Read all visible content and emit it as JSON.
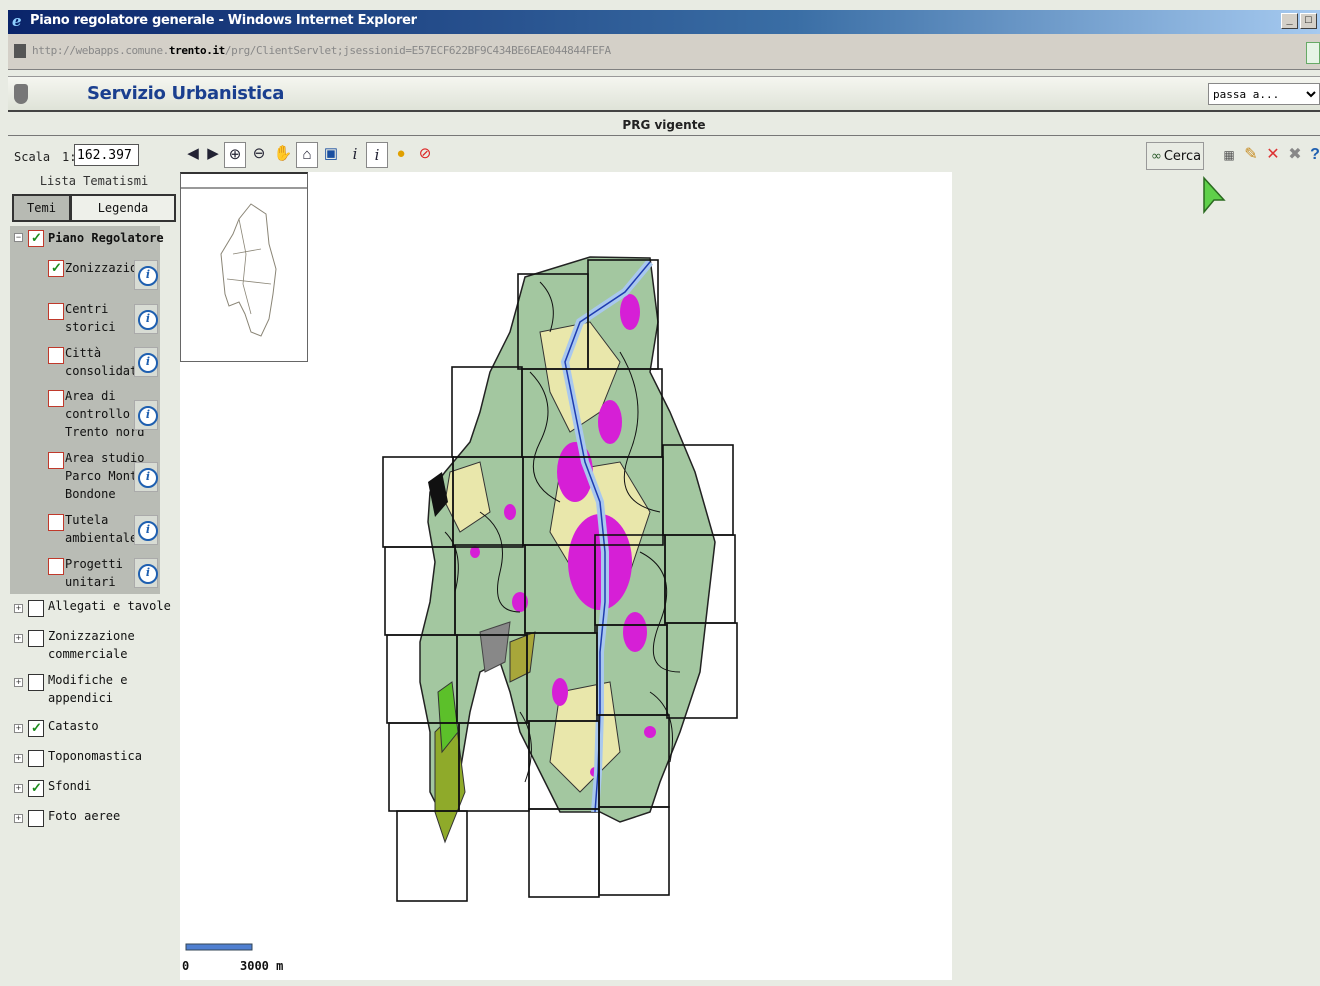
{
  "window": {
    "title": "Piano regolatore generale - Windows Internet Explorer",
    "buttons": [
      "_",
      "□"
    ]
  },
  "address": {
    "url_prefix": "http://webapps.comune.",
    "url_domain": "trento.it",
    "url_suffix": "/prg/ClientServlet;jsessionid=E57ECF622BF9C434BE6EAE044844FEFA"
  },
  "header": {
    "app_title": "Servizio Urbanistica",
    "jump_select": "passa a..."
  },
  "map_title": "PRG vigente",
  "scale": {
    "label": "Scala",
    "prefix": "1:",
    "value": "162.397"
  },
  "panel": {
    "lista_title": "Lista Tematismi",
    "tab_temi": "Temi",
    "tab_legenda": "Legenda"
  },
  "tree": {
    "group": {
      "label": "Piano Regolatore",
      "checked": true
    },
    "layers": [
      {
        "lines": [
          "Zonizzazione"
        ],
        "checked": true
      },
      {
        "lines": [
          "Centri",
          "storici"
        ],
        "checked": false
      },
      {
        "lines": [
          "Città",
          "consolidata"
        ],
        "checked": false
      },
      {
        "lines": [
          "Area di",
          "controllo",
          "Trento nord"
        ],
        "checked": false
      },
      {
        "lines": [
          "Area studio",
          "Parco Monte",
          "Bondone"
        ],
        "checked": false
      },
      {
        "lines": [
          "Tutela",
          "ambientale"
        ],
        "checked": false
      },
      {
        "lines": [
          "Progetti",
          "unitari"
        ],
        "checked": false
      }
    ],
    "groups": [
      {
        "lines": [
          "Allegati e tavole"
        ],
        "checked": false
      },
      {
        "lines": [
          "Zonizzazione",
          "commerciale"
        ],
        "checked": false
      },
      {
        "lines": [
          "Modifiche e",
          "appendici"
        ],
        "checked": false
      },
      {
        "lines": [
          "Catasto"
        ],
        "checked": true
      },
      {
        "lines": [
          "Toponomastica"
        ],
        "checked": false
      },
      {
        "lines": [
          "Sfondi"
        ],
        "checked": true
      },
      {
        "lines": [
          "Foto aeree"
        ],
        "checked": false
      }
    ]
  },
  "right_tools": {
    "cerca_label": "Cerca"
  },
  "scalebar": {
    "start": "0",
    "end": "3000 m"
  },
  "colors": {
    "title_blue": "#0a246a",
    "app_title": "#1a3f8f",
    "zone_green": "#9fc49f",
    "zone_yellow": "#e6e6a8",
    "zone_magenta": "#d61fd6",
    "river_blue": "#a9c8ee"
  }
}
